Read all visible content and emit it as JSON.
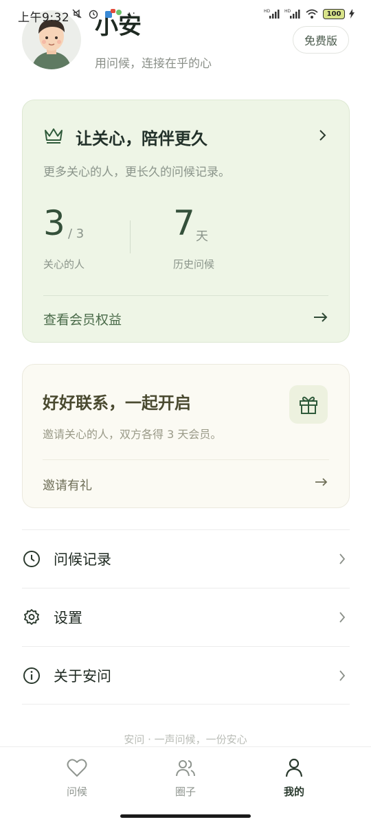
{
  "status_bar": {
    "time": "上午9:32",
    "battery": "100",
    "network_left": "HD",
    "network_right": "HD"
  },
  "profile": {
    "name": "小安",
    "tagline": "用问候，连接在乎的心",
    "plan_badge": "免费版"
  },
  "membership_card": {
    "title": "让关心，陪伴更久",
    "description": "更多关心的人，更长久的问候记录。",
    "stats": [
      {
        "value": "3",
        "unit": "/ 3",
        "label": "关心的人"
      },
      {
        "value": "7",
        "unit": "天",
        "label": "历史问候"
      }
    ],
    "link_label": "查看会员权益",
    "icon": "crown-icon"
  },
  "invite_card": {
    "title": "好好联系，一起开启",
    "description": "邀请关心的人，双方各得 3 天会员。",
    "link_label": "邀请有礼",
    "icon": "gift-icon"
  },
  "menu": [
    {
      "label": "问候记录",
      "icon": "clock-icon"
    },
    {
      "label": "设置",
      "icon": "gear-icon"
    },
    {
      "label": "关于安问",
      "icon": "info-icon"
    }
  ],
  "footer": {
    "slogan": "安问 · 一声问候，一份安心"
  },
  "tabbar": {
    "tabs": [
      {
        "label": "问候",
        "icon": "heart-icon",
        "active": false
      },
      {
        "label": "圈子",
        "icon": "people-icon",
        "active": false
      },
      {
        "label": "我的",
        "icon": "person-icon",
        "active": true
      }
    ]
  },
  "colors": {
    "accent": "#34503a",
    "member_card_bg": "#eef5e6",
    "invite_card_bg": "#fbfaf3"
  }
}
